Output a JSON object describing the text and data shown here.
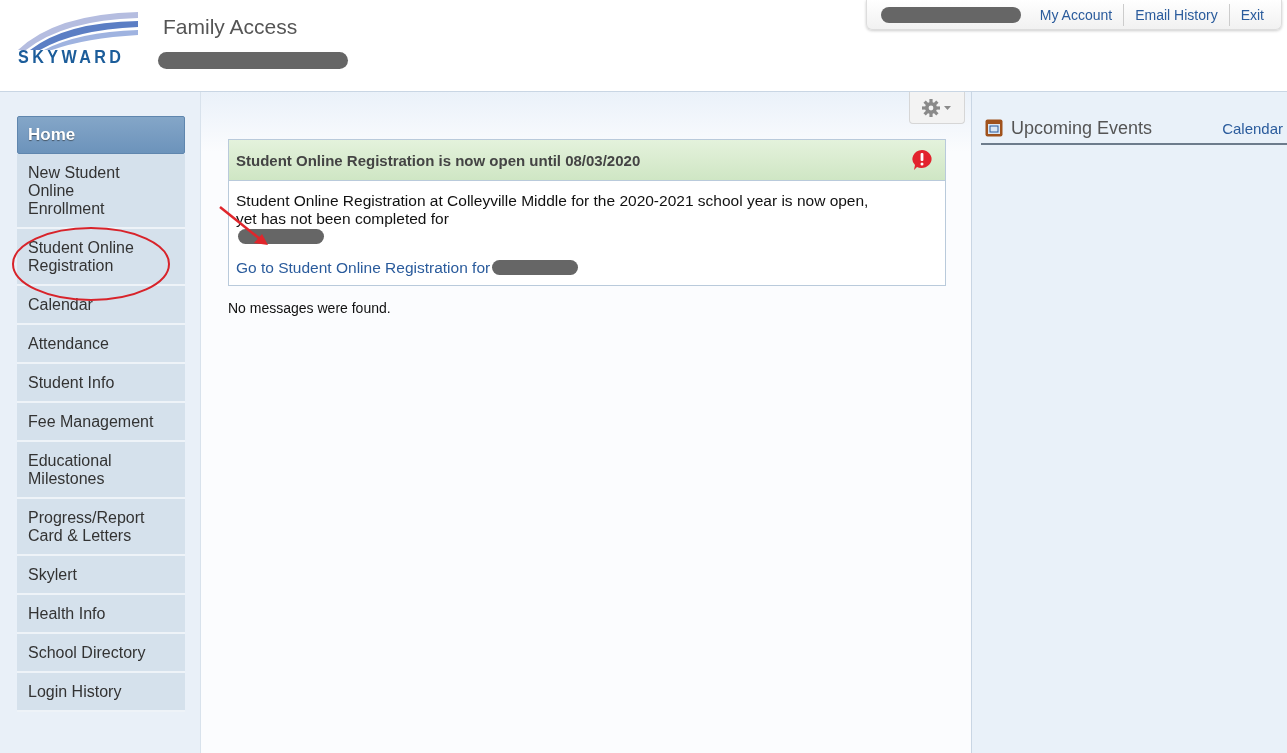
{
  "header": {
    "logo_text": "SKYWARD",
    "app_title": "Family Access",
    "account_links": [
      {
        "label": "My Account"
      },
      {
        "label": "Email History"
      },
      {
        "label": "Exit"
      }
    ]
  },
  "sidebar": {
    "items": [
      {
        "label": "Home",
        "selected": true
      },
      {
        "label": "New Student Online Enrollment",
        "selected": false
      },
      {
        "label": "Student Online Registration",
        "selected": false
      },
      {
        "label": "Calendar",
        "selected": false
      },
      {
        "label": "Attendance",
        "selected": false
      },
      {
        "label": "Student Info",
        "selected": false
      },
      {
        "label": "Fee Management",
        "selected": false
      },
      {
        "label": "Educational Milestones",
        "selected": false
      },
      {
        "label": "Progress/Report Card & Letters",
        "selected": false
      },
      {
        "label": "Skylert",
        "selected": false
      },
      {
        "label": "Health Info",
        "selected": false
      },
      {
        "label": "School Directory",
        "selected": false
      },
      {
        "label": "Login History",
        "selected": false
      }
    ]
  },
  "main": {
    "alert": {
      "title": "Student Online Registration is now open until 08/03/2020",
      "message": "Student Online Registration at Colleyville Middle for the 2020-2021 school year is now open, yet has not been completed for",
      "link": "Go to Student Online Registration for"
    },
    "empty_message": "No messages were found."
  },
  "events_panel": {
    "title": "Upcoming Events",
    "link": "Calendar"
  }
}
